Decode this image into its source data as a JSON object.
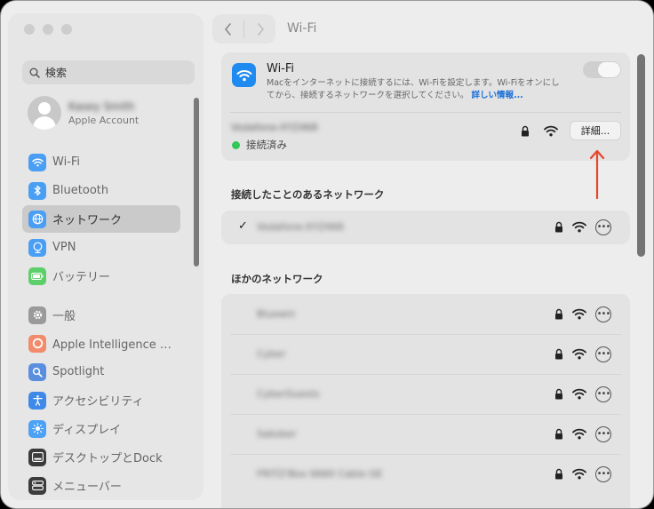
{
  "sidebar": {
    "search_placeholder": "検索",
    "account": {
      "name": "Kasey Smith",
      "subtitle": "Apple Account"
    },
    "items_top": [
      {
        "label": "Wi-Fi",
        "icon": "wifi-icon",
        "color": "#4a9ef3"
      },
      {
        "label": "Bluetooth",
        "icon": "bluetooth-icon",
        "color": "#4a9ef3"
      },
      {
        "label": "ネットワーク",
        "icon": "globe-icon",
        "color": "#4a9ef3",
        "active": true
      },
      {
        "label": "VPN",
        "icon": "vpn-icon",
        "color": "#4a9ef3"
      },
      {
        "label": "バッテリー",
        "icon": "battery-icon",
        "color": "#5ccf6a"
      }
    ],
    "items_bottom": [
      {
        "label": "一般",
        "icon": "gear-icon",
        "color": "#9a9a9a"
      },
      {
        "label": "Apple Intelligence と…",
        "icon": "apple-intelligence-icon",
        "color": "#f28b6c"
      },
      {
        "label": "Spotlight",
        "icon": "spotlight-icon",
        "color": "#5a8fe0"
      },
      {
        "label": "アクセシビリティ",
        "icon": "accessibility-icon",
        "color": "#3f89e8"
      },
      {
        "label": "ディスプレイ",
        "icon": "display-icon",
        "color": "#4da2f5"
      },
      {
        "label": "デスクトップとDock",
        "icon": "dock-icon",
        "color": "#3b3b3b"
      },
      {
        "label": "メニューバー",
        "icon": "menubar-icon",
        "color": "#3b3b3b"
      }
    ]
  },
  "toolbar": {
    "title": "Wi-Fi"
  },
  "wifi": {
    "title": "Wi-Fi",
    "description": "Macをインターネットに接続するには、Wi-Fiを設定します。Wi-Fiをオンにしてから、接続するネットワークを選択してください。",
    "link": "詳しい情報...",
    "toggle_on": false,
    "current_network": "Vodafone-XYZ468",
    "status": "接続済み",
    "details_button": "詳細..."
  },
  "known_section": {
    "title": "接続したことのあるネットワーク",
    "networks": [
      {
        "name": "Vodafone-XYZ468",
        "checked": true
      }
    ]
  },
  "other_section": {
    "title": "ほかのネットワーク",
    "networks": [
      {
        "name": "Bluewin"
      },
      {
        "name": "Cyber"
      },
      {
        "name": "CyberGuests"
      },
      {
        "name": "Sabsber"
      },
      {
        "name": "FRITZ!Box 6660 Cable GE"
      }
    ]
  },
  "colors": {
    "accent": "#1f8bf0",
    "arrow": "#e8452c",
    "connected": "#33c659"
  }
}
